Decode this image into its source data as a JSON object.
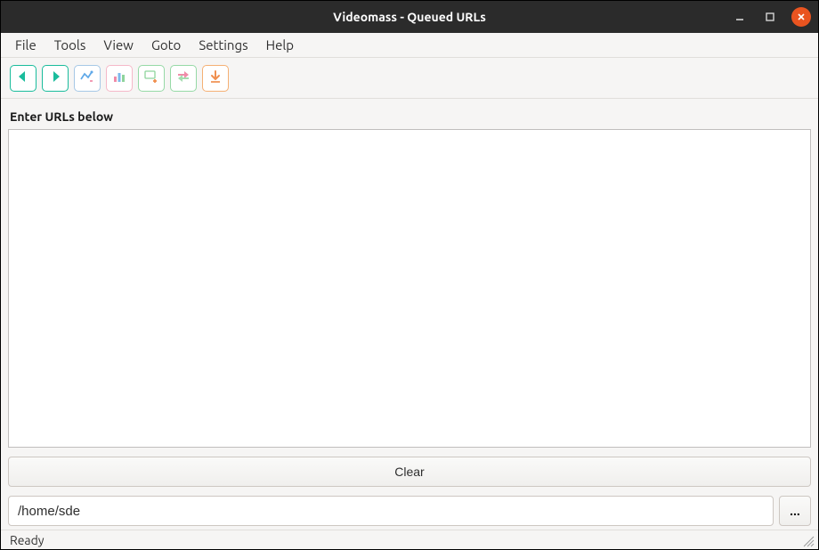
{
  "window": {
    "title": "Videomass - Queued URLs"
  },
  "menu": {
    "items": [
      "File",
      "Tools",
      "View",
      "Goto",
      "Settings",
      "Help"
    ]
  },
  "toolbar": {
    "buttons": [
      {
        "name": "back-icon",
        "style": "teal"
      },
      {
        "name": "forward-icon",
        "style": "teal"
      },
      {
        "name": "stats-icon",
        "style": "blue"
      },
      {
        "name": "chart-icon",
        "style": "pink"
      },
      {
        "name": "add-icon",
        "style": "green"
      },
      {
        "name": "convert-icon",
        "style": "green"
      },
      {
        "name": "download-icon",
        "style": "orange"
      }
    ]
  },
  "main": {
    "url_label": "Enter URLs below",
    "url_value": "",
    "clear_label": "Clear",
    "path_value": "/home/sde",
    "browse_label": "..."
  },
  "status": {
    "text": "Ready"
  }
}
